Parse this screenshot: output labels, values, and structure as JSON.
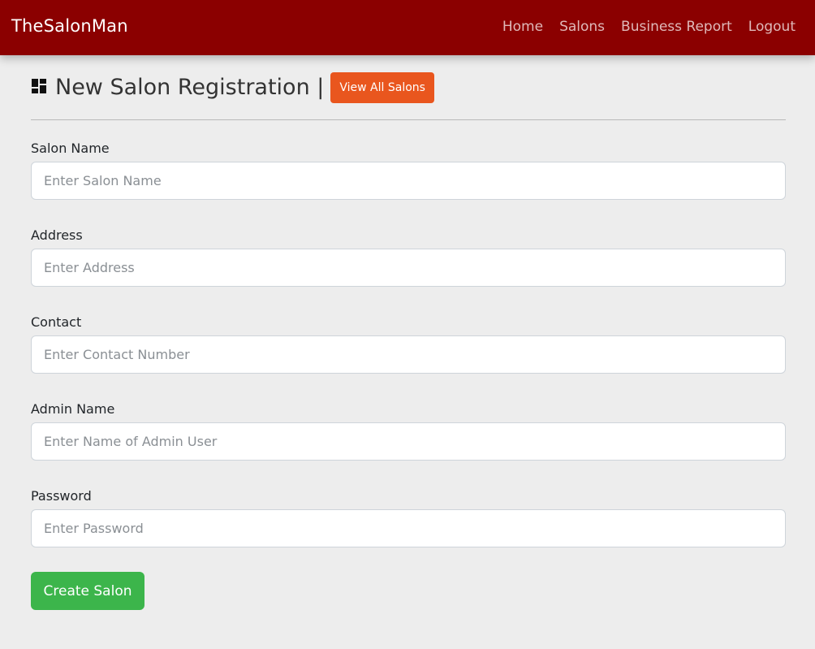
{
  "navbar": {
    "brand": "TheSalonMan",
    "links": [
      {
        "label": "Home"
      },
      {
        "label": "Salons"
      },
      {
        "label": "Business Report"
      },
      {
        "label": "Logout"
      }
    ],
    "background_color": "#8b0000"
  },
  "header": {
    "icon": "dashboard-icon",
    "title": "New Salon Registration |",
    "view_all_button": "View All Salons",
    "view_all_button_color": "#e9561e"
  },
  "form": {
    "fields": [
      {
        "label": "Salon Name",
        "placeholder": "Enter Salon Name",
        "value": ""
      },
      {
        "label": "Address",
        "placeholder": "Enter Address",
        "value": ""
      },
      {
        "label": "Contact",
        "placeholder": "Enter Contact Number",
        "value": ""
      },
      {
        "label": "Admin Name",
        "placeholder": "Enter Name of Admin User",
        "value": ""
      },
      {
        "label": "Password",
        "placeholder": "Enter Password",
        "value": ""
      }
    ],
    "submit_label": "Create Salon",
    "submit_color": "#3cb54b"
  }
}
